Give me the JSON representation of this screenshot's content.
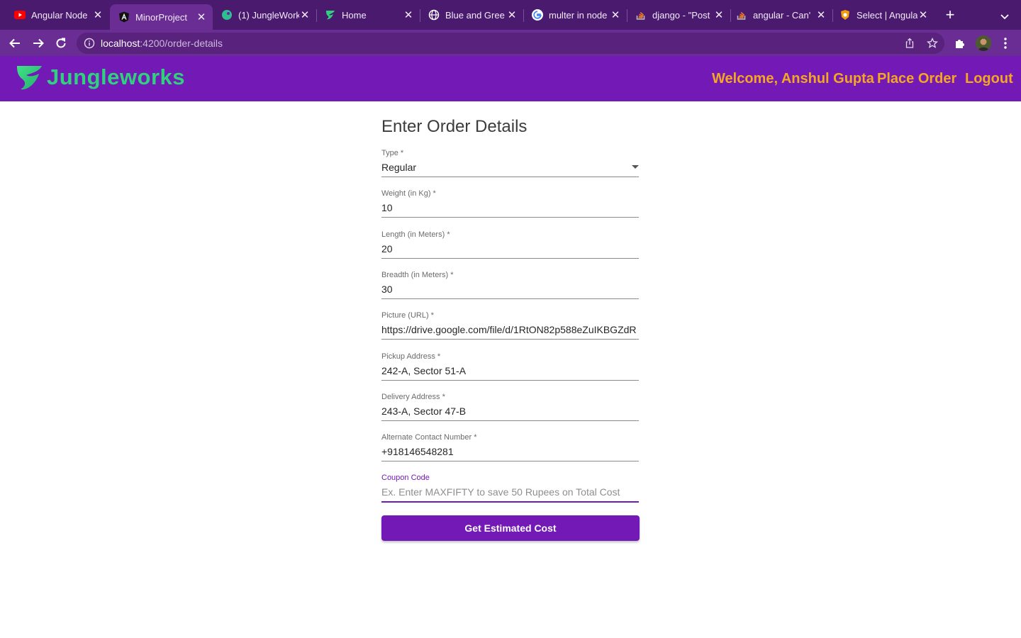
{
  "browser": {
    "tabs": [
      {
        "title": "Angular Node",
        "icon": "youtube-icon"
      },
      {
        "title": "MinorProject",
        "icon": "angular-icon",
        "active": true
      },
      {
        "title": "(1) JungleWork",
        "icon": "parrot-icon"
      },
      {
        "title": "Home",
        "icon": "jungleworks-icon"
      },
      {
        "title": "Blue and Gree",
        "icon": "globe-icon"
      },
      {
        "title": "multer in node",
        "icon": "google-icon"
      },
      {
        "title": "django - \"Post",
        "icon": "stackoverflow-icon"
      },
      {
        "title": "angular - Can'",
        "icon": "stackoverflow-icon"
      },
      {
        "title": "Select | Angula",
        "icon": "shield-icon"
      }
    ],
    "url_host": "localhost",
    "url_rest": ":4200/order-details"
  },
  "app": {
    "brand": "Jungleworks",
    "nav": {
      "welcome": "Welcome, Anshul Gupta",
      "place_order": "Place Order",
      "logout": "Logout"
    },
    "colors": {
      "primary": "#7319b6",
      "accent": "#f5a623",
      "brand_green": "#2fd17e"
    }
  },
  "form": {
    "title": "Enter Order Details",
    "fields": {
      "type": {
        "label": "Type *",
        "value": "Regular"
      },
      "weight": {
        "label": "Weight (in Kg) *",
        "value": "10"
      },
      "length": {
        "label": "Length (in Meters) *",
        "value": "20"
      },
      "breadth": {
        "label": "Breadth (in Meters) *",
        "value": "30"
      },
      "picture": {
        "label": "Picture (URL) *",
        "value": "https://drive.google.com/file/d/1RtON82p588eZuIKBGZdR"
      },
      "pickup": {
        "label": "Pickup Address *",
        "value": "242-A, Sector 51-A"
      },
      "delivery": {
        "label": "Delivery Address *",
        "value": "243-A, Sector 47-B"
      },
      "contact": {
        "label": "Alternate Contact Number *",
        "value": "+918146548281"
      },
      "coupon": {
        "label": "Coupon Code",
        "placeholder": "Ex. Enter MAXFIFTY to save 50 Rupees on Total Cost"
      }
    },
    "submit_label": "Get Estimated Cost"
  }
}
